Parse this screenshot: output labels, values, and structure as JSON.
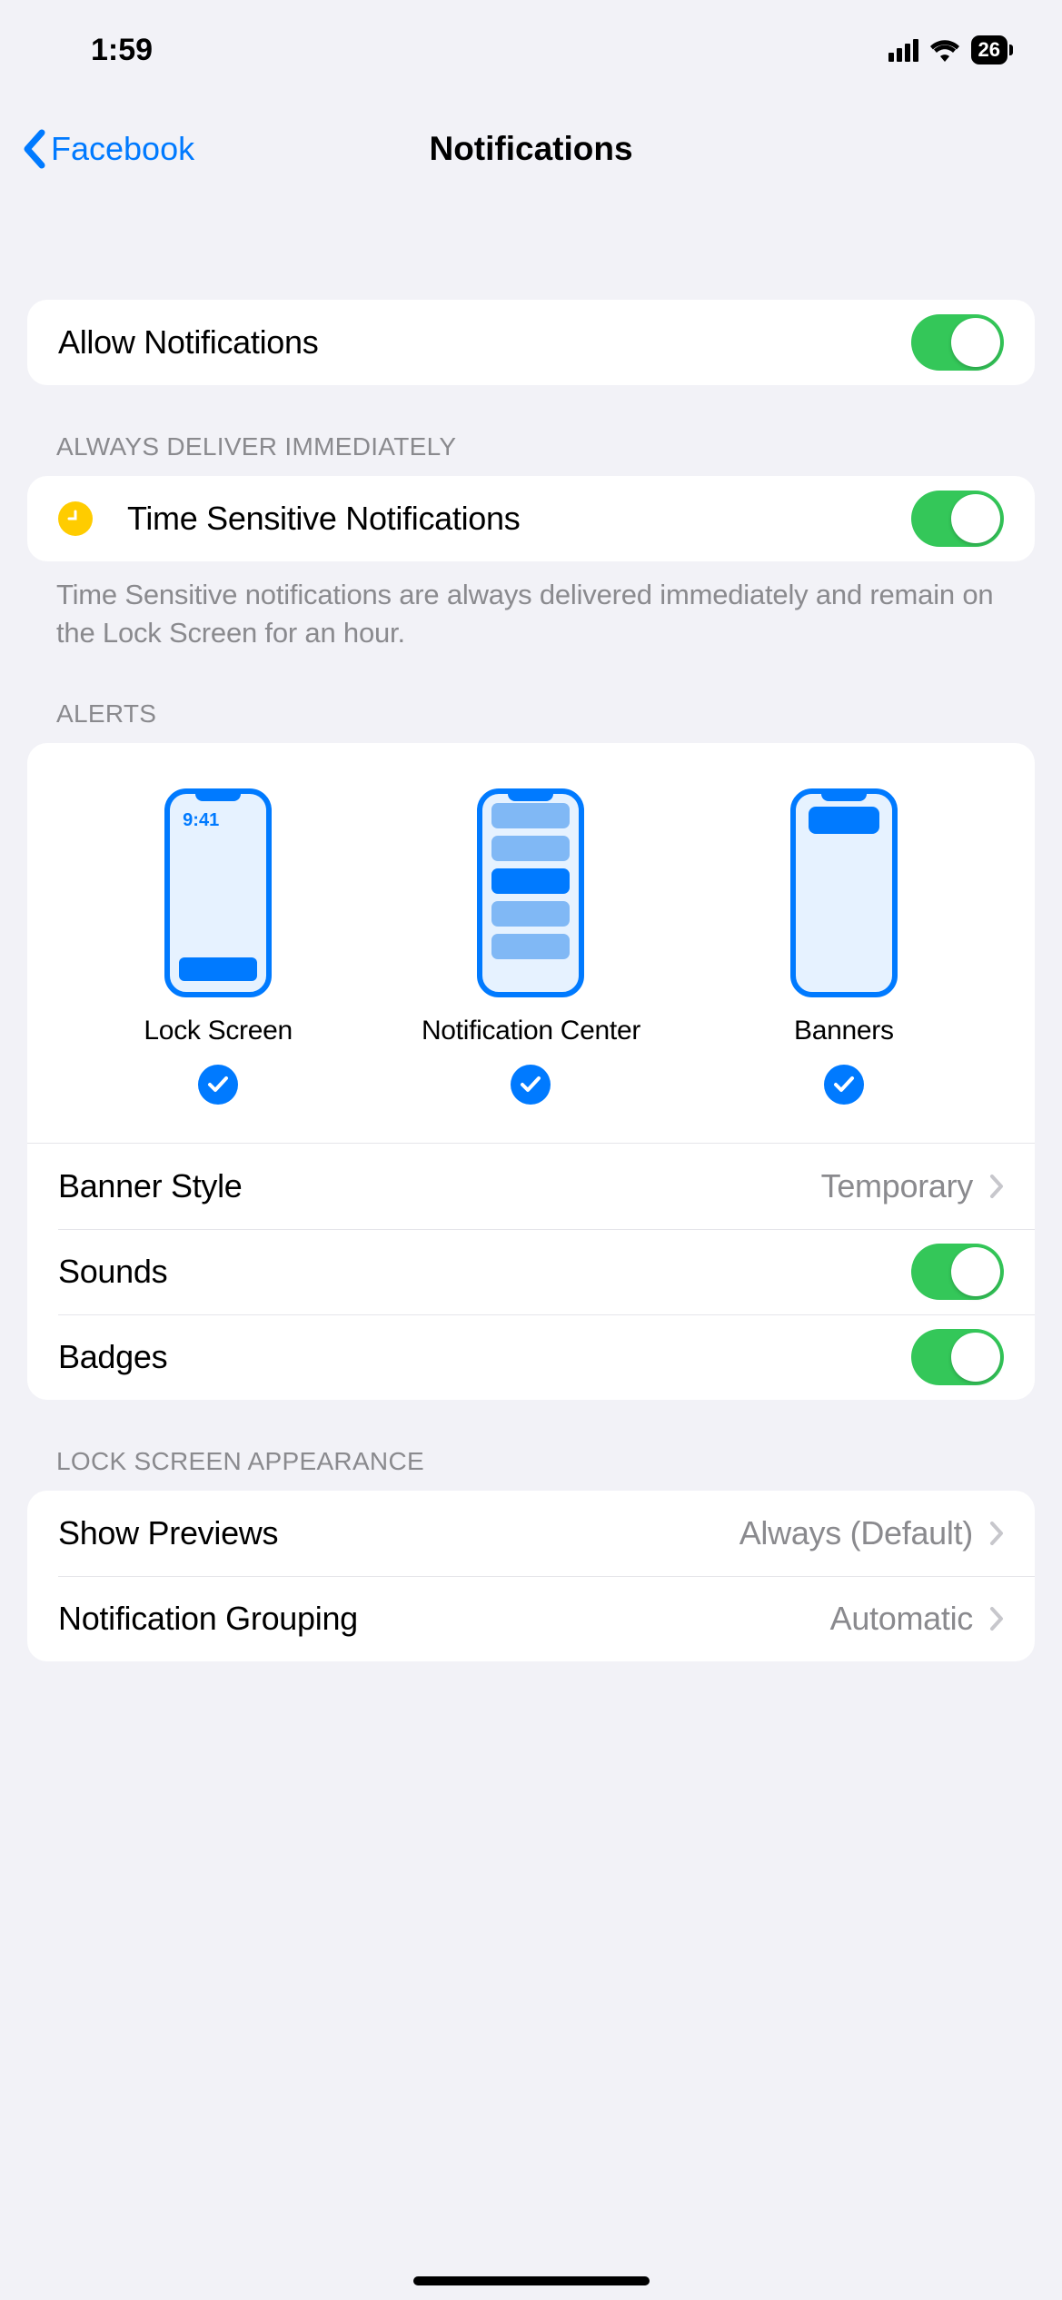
{
  "status": {
    "time": "1:59",
    "battery": "26"
  },
  "nav": {
    "back": "Facebook",
    "title": "Notifications"
  },
  "allow": {
    "label": "Allow Notifications",
    "on": true
  },
  "timeSensitive": {
    "header": "ALWAYS DELIVER IMMEDIATELY",
    "label": "Time Sensitive Notifications",
    "on": true,
    "footer": "Time Sensitive notifications are always delivered immediately and remain on the Lock Screen for an hour."
  },
  "alerts": {
    "header": "ALERTS",
    "lockScreen": {
      "label": "Lock Screen",
      "time": "9:41",
      "checked": true
    },
    "notificationCenter": {
      "label": "Notification Center",
      "checked": true
    },
    "banners": {
      "label": "Banners",
      "checked": true
    },
    "bannerStyle": {
      "label": "Banner Style",
      "value": "Temporary"
    },
    "sounds": {
      "label": "Sounds",
      "on": true
    },
    "badges": {
      "label": "Badges",
      "on": true
    }
  },
  "lockAppearance": {
    "header": "LOCK SCREEN APPEARANCE",
    "showPreviews": {
      "label": "Show Previews",
      "value": "Always (Default)"
    },
    "grouping": {
      "label": "Notification Grouping",
      "value": "Automatic"
    }
  }
}
